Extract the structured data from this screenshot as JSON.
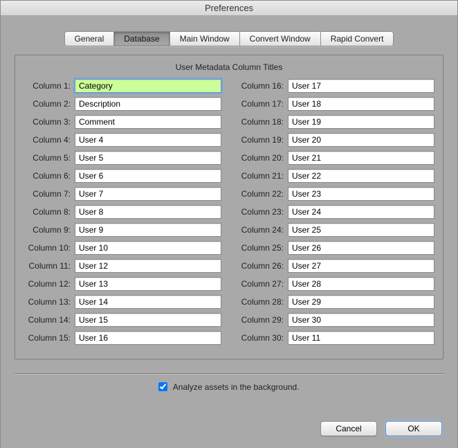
{
  "window": {
    "title": "Preferences"
  },
  "tabs": [
    "General",
    "Database",
    "Main Window",
    "Convert Window",
    "Rapid Convert"
  ],
  "active_tab": 1,
  "section_title": "User Metadata Column Titles",
  "left_columns": [
    {
      "label": "Column 1:",
      "value": "Category",
      "focused": true
    },
    {
      "label": "Column 2:",
      "value": "Description",
      "focused": false
    },
    {
      "label": "Column 3:",
      "value": "Comment",
      "focused": false
    },
    {
      "label": "Column 4:",
      "value": "User 4",
      "focused": false
    },
    {
      "label": "Column 5:",
      "value": "User 5",
      "focused": false
    },
    {
      "label": "Column 6:",
      "value": "User 6",
      "focused": false
    },
    {
      "label": "Column 7:",
      "value": "User 7",
      "focused": false
    },
    {
      "label": "Column 8:",
      "value": "User 8",
      "focused": false
    },
    {
      "label": "Column 9:",
      "value": "User 9",
      "focused": false
    },
    {
      "label": "Column 10:",
      "value": "User 10",
      "focused": false
    },
    {
      "label": "Column 11:",
      "value": "User 12",
      "focused": false
    },
    {
      "label": "Column 12:",
      "value": "User 13",
      "focused": false
    },
    {
      "label": "Column 13:",
      "value": "User 14",
      "focused": false
    },
    {
      "label": "Column 14:",
      "value": "User 15",
      "focused": false
    },
    {
      "label": "Column 15:",
      "value": "User 16",
      "focused": false
    }
  ],
  "right_columns": [
    {
      "label": "Column 16:",
      "value": "User 17",
      "focused": false
    },
    {
      "label": "Column 17:",
      "value": "User 18",
      "focused": false
    },
    {
      "label": "Column 18:",
      "value": "User 19",
      "focused": false
    },
    {
      "label": "Column 19:",
      "value": "User 20",
      "focused": false
    },
    {
      "label": "Column 20:",
      "value": "User 21",
      "focused": false
    },
    {
      "label": "Column 21:",
      "value": "User 22",
      "focused": false
    },
    {
      "label": "Column 22:",
      "value": "User 23",
      "focused": false
    },
    {
      "label": "Column 23:",
      "value": "User 24",
      "focused": false
    },
    {
      "label": "Column 24:",
      "value": "User 25",
      "focused": false
    },
    {
      "label": "Column 25:",
      "value": "User 26",
      "focused": false
    },
    {
      "label": "Column 26:",
      "value": "User 27",
      "focused": false
    },
    {
      "label": "Column 27:",
      "value": "User 28",
      "focused": false
    },
    {
      "label": "Column 28:",
      "value": "User 29",
      "focused": false
    },
    {
      "label": "Column 29:",
      "value": "User 30",
      "focused": false
    },
    {
      "label": "Column 30:",
      "value": "User 11",
      "focused": false
    }
  ],
  "checkbox": {
    "label": "Analyze assets in the background.",
    "checked": true
  },
  "buttons": {
    "cancel": "Cancel",
    "ok": "OK"
  }
}
